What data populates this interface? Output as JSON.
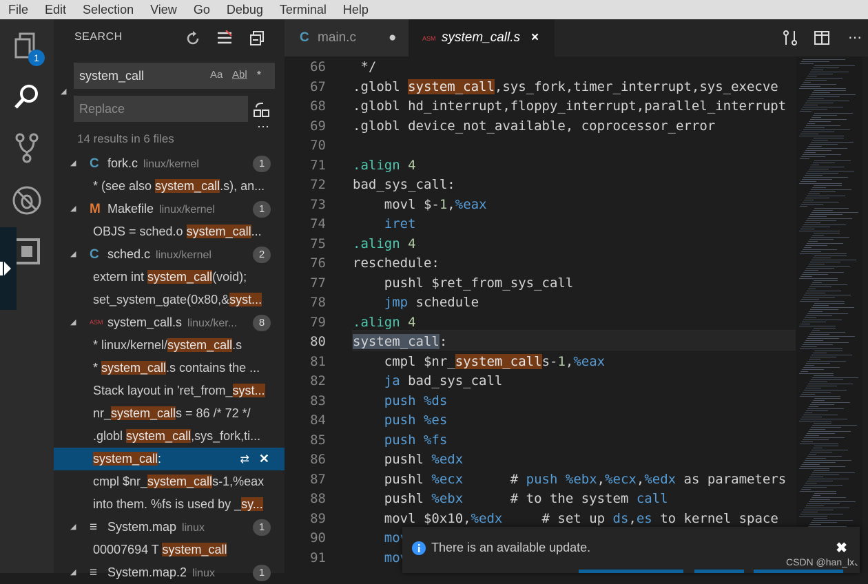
{
  "menubar": [
    "File",
    "Edit",
    "Selection",
    "View",
    "Go",
    "Debug",
    "Terminal",
    "Help"
  ],
  "activity": {
    "badge": "1"
  },
  "sidebar": {
    "title": "SEARCH",
    "search_value": "system_call",
    "search_opts": [
      "Aa",
      "Abl",
      "*"
    ],
    "replace_placeholder": "Replace",
    "summary": "14 results in 6 files",
    "files": [
      {
        "icon": "C",
        "icon_color": "#519aba",
        "name": "fork.c",
        "path": "linux/kernel",
        "count": "1",
        "matches": [
          {
            "pre": "* (see also ",
            "hit": "system_call",
            "post": ".s), an..."
          }
        ]
      },
      {
        "icon": "M",
        "icon_color": "#e37933",
        "name": "Makefile",
        "path": "linux/kernel",
        "count": "1",
        "matches": [
          {
            "pre": "OBJS  = sched.o ",
            "hit": "system_call",
            "post": "..."
          }
        ]
      },
      {
        "icon": "C",
        "icon_color": "#519aba",
        "name": "sched.c",
        "path": "linux/kernel",
        "count": "2",
        "matches": [
          {
            "pre": "extern int ",
            "hit": "system_call",
            "post": "(void);"
          },
          {
            "pre": "set_system_gate(0x80,&",
            "hit": "syst...",
            "post": ""
          }
        ]
      },
      {
        "icon": "ASM",
        "icon_color": "#cc3e44",
        "name": "system_call.s",
        "path": "linux/ker...",
        "count": "8",
        "matches": [
          {
            "pre": "*  linux/kernel/",
            "hit": "system_call",
            "post": ".s"
          },
          {
            "pre": "*  ",
            "hit": "system_call",
            "post": ".s  contains the ..."
          },
          {
            "pre": "Stack layout in 'ret_from_",
            "hit": "syst...",
            "post": ""
          },
          {
            "pre": "nr_",
            "hit": "system_call",
            "post": "s = 86  /* 72 */"
          },
          {
            "pre": ".globl ",
            "hit": "system_call",
            "post": ",sys_fork,ti..."
          },
          {
            "pre": "",
            "hit": "system_call",
            "post": ":",
            "selected": true
          },
          {
            "pre": "cmpl $nr_",
            "hit": "system_call",
            "post": "s-1,%eax"
          },
          {
            "pre": "into them. %fs is used by _",
            "hit": "sy...",
            "post": ""
          }
        ]
      },
      {
        "icon": "≡",
        "icon_color": "#cccccc",
        "name": "System.map",
        "path": "linux",
        "count": "1",
        "matches": [
          {
            "pre": "00007694 T ",
            "hit": "system_call",
            "post": ""
          }
        ]
      },
      {
        "icon": "≡",
        "icon_color": "#cccccc",
        "name": "System.map.2",
        "path": "linux",
        "count": "1",
        "matches": []
      }
    ]
  },
  "tabs": [
    {
      "icon": "C",
      "label": "main.c",
      "dirty": "●"
    },
    {
      "icon": "ASM",
      "label": "system_call.s",
      "close": "×"
    }
  ],
  "code": [
    {
      "n": "66",
      "t": [
        [
          "t",
          " */"
        ]
      ]
    },
    {
      "n": "67",
      "t": [
        [
          "t",
          ".globl "
        ],
        [
          "h",
          "system_call"
        ],
        [
          "t",
          ",sys_fork,timer_interrupt,sys_execve"
        ]
      ]
    },
    {
      "n": "68",
      "t": [
        [
          "t",
          ".globl hd_interrupt,floppy_interrupt,parallel_interrupt"
        ]
      ]
    },
    {
      "n": "69",
      "t": [
        [
          "t",
          ".globl device_not_available, coprocessor_error"
        ]
      ]
    },
    {
      "n": "70",
      "t": [
        [
          "t",
          ""
        ]
      ]
    },
    {
      "n": "71",
      "t": [
        [
          "d",
          ".align "
        ],
        [
          "n",
          "4"
        ]
      ]
    },
    {
      "n": "72",
      "t": [
        [
          "t",
          "bad_sys_call:"
        ]
      ]
    },
    {
      "n": "73",
      "t": [
        [
          "t",
          "    movl $-"
        ],
        [
          "n",
          "1"
        ],
        [
          "t",
          ","
        ],
        [
          "r",
          "%eax"
        ]
      ]
    },
    {
      "n": "74",
      "t": [
        [
          "t",
          "    "
        ],
        [
          "k",
          "iret"
        ]
      ]
    },
    {
      "n": "75",
      "t": [
        [
          "d",
          ".align "
        ],
        [
          "n",
          "4"
        ]
      ]
    },
    {
      "n": "76",
      "t": [
        [
          "t",
          "reschedule:"
        ]
      ]
    },
    {
      "n": "77",
      "t": [
        [
          "t",
          "    pushl $ret_from_sys_call"
        ]
      ]
    },
    {
      "n": "78",
      "t": [
        [
          "t",
          "    "
        ],
        [
          "k",
          "jmp"
        ],
        [
          "t",
          " schedule"
        ]
      ]
    },
    {
      "n": "79",
      "t": [
        [
          "d",
          ".align "
        ],
        [
          "n",
          "4"
        ]
      ]
    },
    {
      "n": "80",
      "t": [
        [
          "s",
          "system_call"
        ],
        [
          "t",
          ":"
        ]
      ]
    },
    {
      "n": "81",
      "t": [
        [
          "t",
          "    cmpl $nr_"
        ],
        [
          "h",
          "system_call"
        ],
        [
          "t",
          "s-"
        ],
        [
          "n",
          "1"
        ],
        [
          "t",
          ","
        ],
        [
          "r",
          "%eax"
        ]
      ]
    },
    {
      "n": "82",
      "t": [
        [
          "t",
          "    "
        ],
        [
          "k",
          "ja"
        ],
        [
          "t",
          " bad_sys_call"
        ]
      ]
    },
    {
      "n": "83",
      "t": [
        [
          "t",
          "    "
        ],
        [
          "k",
          "push"
        ],
        [
          "t",
          " "
        ],
        [
          "r",
          "%ds"
        ]
      ]
    },
    {
      "n": "84",
      "t": [
        [
          "t",
          "    "
        ],
        [
          "k",
          "push"
        ],
        [
          "t",
          " "
        ],
        [
          "r",
          "%es"
        ]
      ]
    },
    {
      "n": "85",
      "t": [
        [
          "t",
          "    "
        ],
        [
          "k",
          "push"
        ],
        [
          "t",
          " "
        ],
        [
          "r",
          "%fs"
        ]
      ]
    },
    {
      "n": "86",
      "t": [
        [
          "t",
          "    pushl "
        ],
        [
          "r",
          "%edx"
        ]
      ]
    },
    {
      "n": "87",
      "t": [
        [
          "t",
          "    pushl "
        ],
        [
          "r",
          "%ecx"
        ],
        [
          "t",
          "      # "
        ],
        [
          "k",
          "push"
        ],
        [
          "t",
          " "
        ],
        [
          "r",
          "%ebx"
        ],
        [
          "t",
          ","
        ],
        [
          "r",
          "%ecx"
        ],
        [
          "t",
          ","
        ],
        [
          "r",
          "%edx"
        ],
        [
          "t",
          " as parameters"
        ]
      ]
    },
    {
      "n": "88",
      "t": [
        [
          "t",
          "    pushl "
        ],
        [
          "r",
          "%ebx"
        ],
        [
          "t",
          "      # to the system "
        ],
        [
          "k",
          "call"
        ]
      ]
    },
    {
      "n": "89",
      "t": [
        [
          "t",
          "    movl $0x10,"
        ],
        [
          "r",
          "%edx"
        ],
        [
          "t",
          "     # set up "
        ],
        [
          "k",
          "ds"
        ],
        [
          "t",
          ","
        ],
        [
          "k",
          "es"
        ],
        [
          "t",
          " to kernel space"
        ]
      ]
    },
    {
      "n": "90",
      "t": [
        [
          "t",
          "    "
        ],
        [
          "k",
          "mov"
        ]
      ]
    },
    {
      "n": "91",
      "t": [
        [
          "t",
          "    "
        ],
        [
          "k",
          "mov"
        ]
      ]
    }
  ],
  "notification": {
    "text": "There is an available update.",
    "close": "✖"
  },
  "watermark": "CSDN @han_lx、"
}
